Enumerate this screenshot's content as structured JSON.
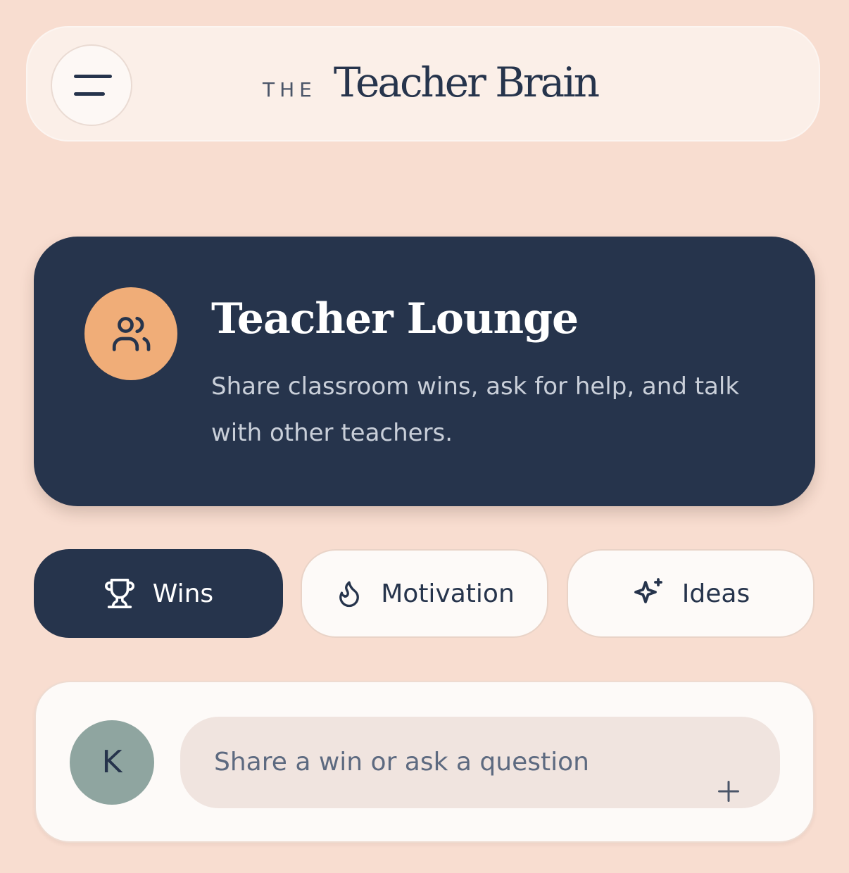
{
  "header": {
    "logo_prefix": "THE",
    "logo_name": "Teacher Brain",
    "menu_icon": "hamburger-menu-icon"
  },
  "hero": {
    "icon": "users-icon",
    "title": "Teacher Lounge",
    "description": "Share classroom wins, ask for help, and talk with other teachers."
  },
  "filters": {
    "selected": "Wins",
    "items": [
      {
        "label": "Wins",
        "icon": "trophy-icon",
        "active": true
      },
      {
        "label": "Motivation",
        "icon": "flame-icon",
        "active": false
      },
      {
        "label": "Ideas",
        "icon": "sparkles-icon",
        "active": false
      }
    ]
  },
  "composer": {
    "avatar_initial": "K",
    "placeholder": "Share a win or ask a question",
    "add_icon": "plus-icon"
  },
  "colors": {
    "background": "#f8ddd0",
    "navy": "#26344c",
    "accent_orange": "#f0ad78",
    "avatar_green": "#8fa5a0"
  }
}
